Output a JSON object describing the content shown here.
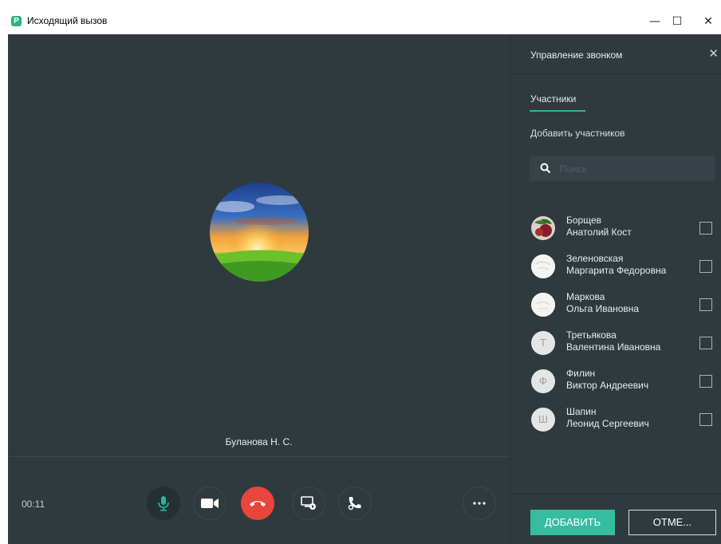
{
  "window": {
    "title": "Исходящий вызов",
    "app_icon_letter": "Р",
    "controls": {
      "minimize": "—",
      "maximize": "☐",
      "close": "✕"
    }
  },
  "call": {
    "caller_name": "Буланова Н. С.",
    "timer": "00:11",
    "controls": [
      {
        "name": "microphone",
        "icon": "mic-icon",
        "state": "active"
      },
      {
        "name": "camera",
        "icon": "video-camera-icon"
      },
      {
        "name": "hangup",
        "icon": "phone-hangup-icon"
      },
      {
        "name": "screen-share",
        "icon": "screen-share-icon"
      },
      {
        "name": "transfer",
        "icon": "call-transfer-icon"
      },
      {
        "name": "more",
        "icon": "more-dots-icon"
      }
    ]
  },
  "panel": {
    "title": "Управление звонком",
    "close": "✕",
    "tab": "Участники",
    "add_label": "Добавить участников",
    "search_placeholder": "Поиск",
    "participants": [
      {
        "last": "Борщев",
        "first": "Анатолий Кост",
        "avatar": "photo"
      },
      {
        "last": "Зеленовская",
        "first": "Маргарита Федоровна",
        "avatar": "blank"
      },
      {
        "last": "Маркова",
        "first": "Ольга Ивановна",
        "avatar": "blank"
      },
      {
        "last": "Третьякова",
        "first": "Валентина Ивановна",
        "avatar": "letter",
        "letter": "Т"
      },
      {
        "last": "Филин",
        "first": "Виктор Андреевич",
        "avatar": "letter",
        "letter": "Ф"
      },
      {
        "last": "Шапин",
        "first": "Леонид Сергеевич",
        "avatar": "letter",
        "letter": "Ш"
      }
    ],
    "add_button": "ДОБАВИТЬ",
    "cancel_button": "ОТМЕ..."
  },
  "colors": {
    "background": "#2f3a3f",
    "accent": "#36bca1",
    "hangup": "#e8453c",
    "mic": "#2cb3a0"
  }
}
